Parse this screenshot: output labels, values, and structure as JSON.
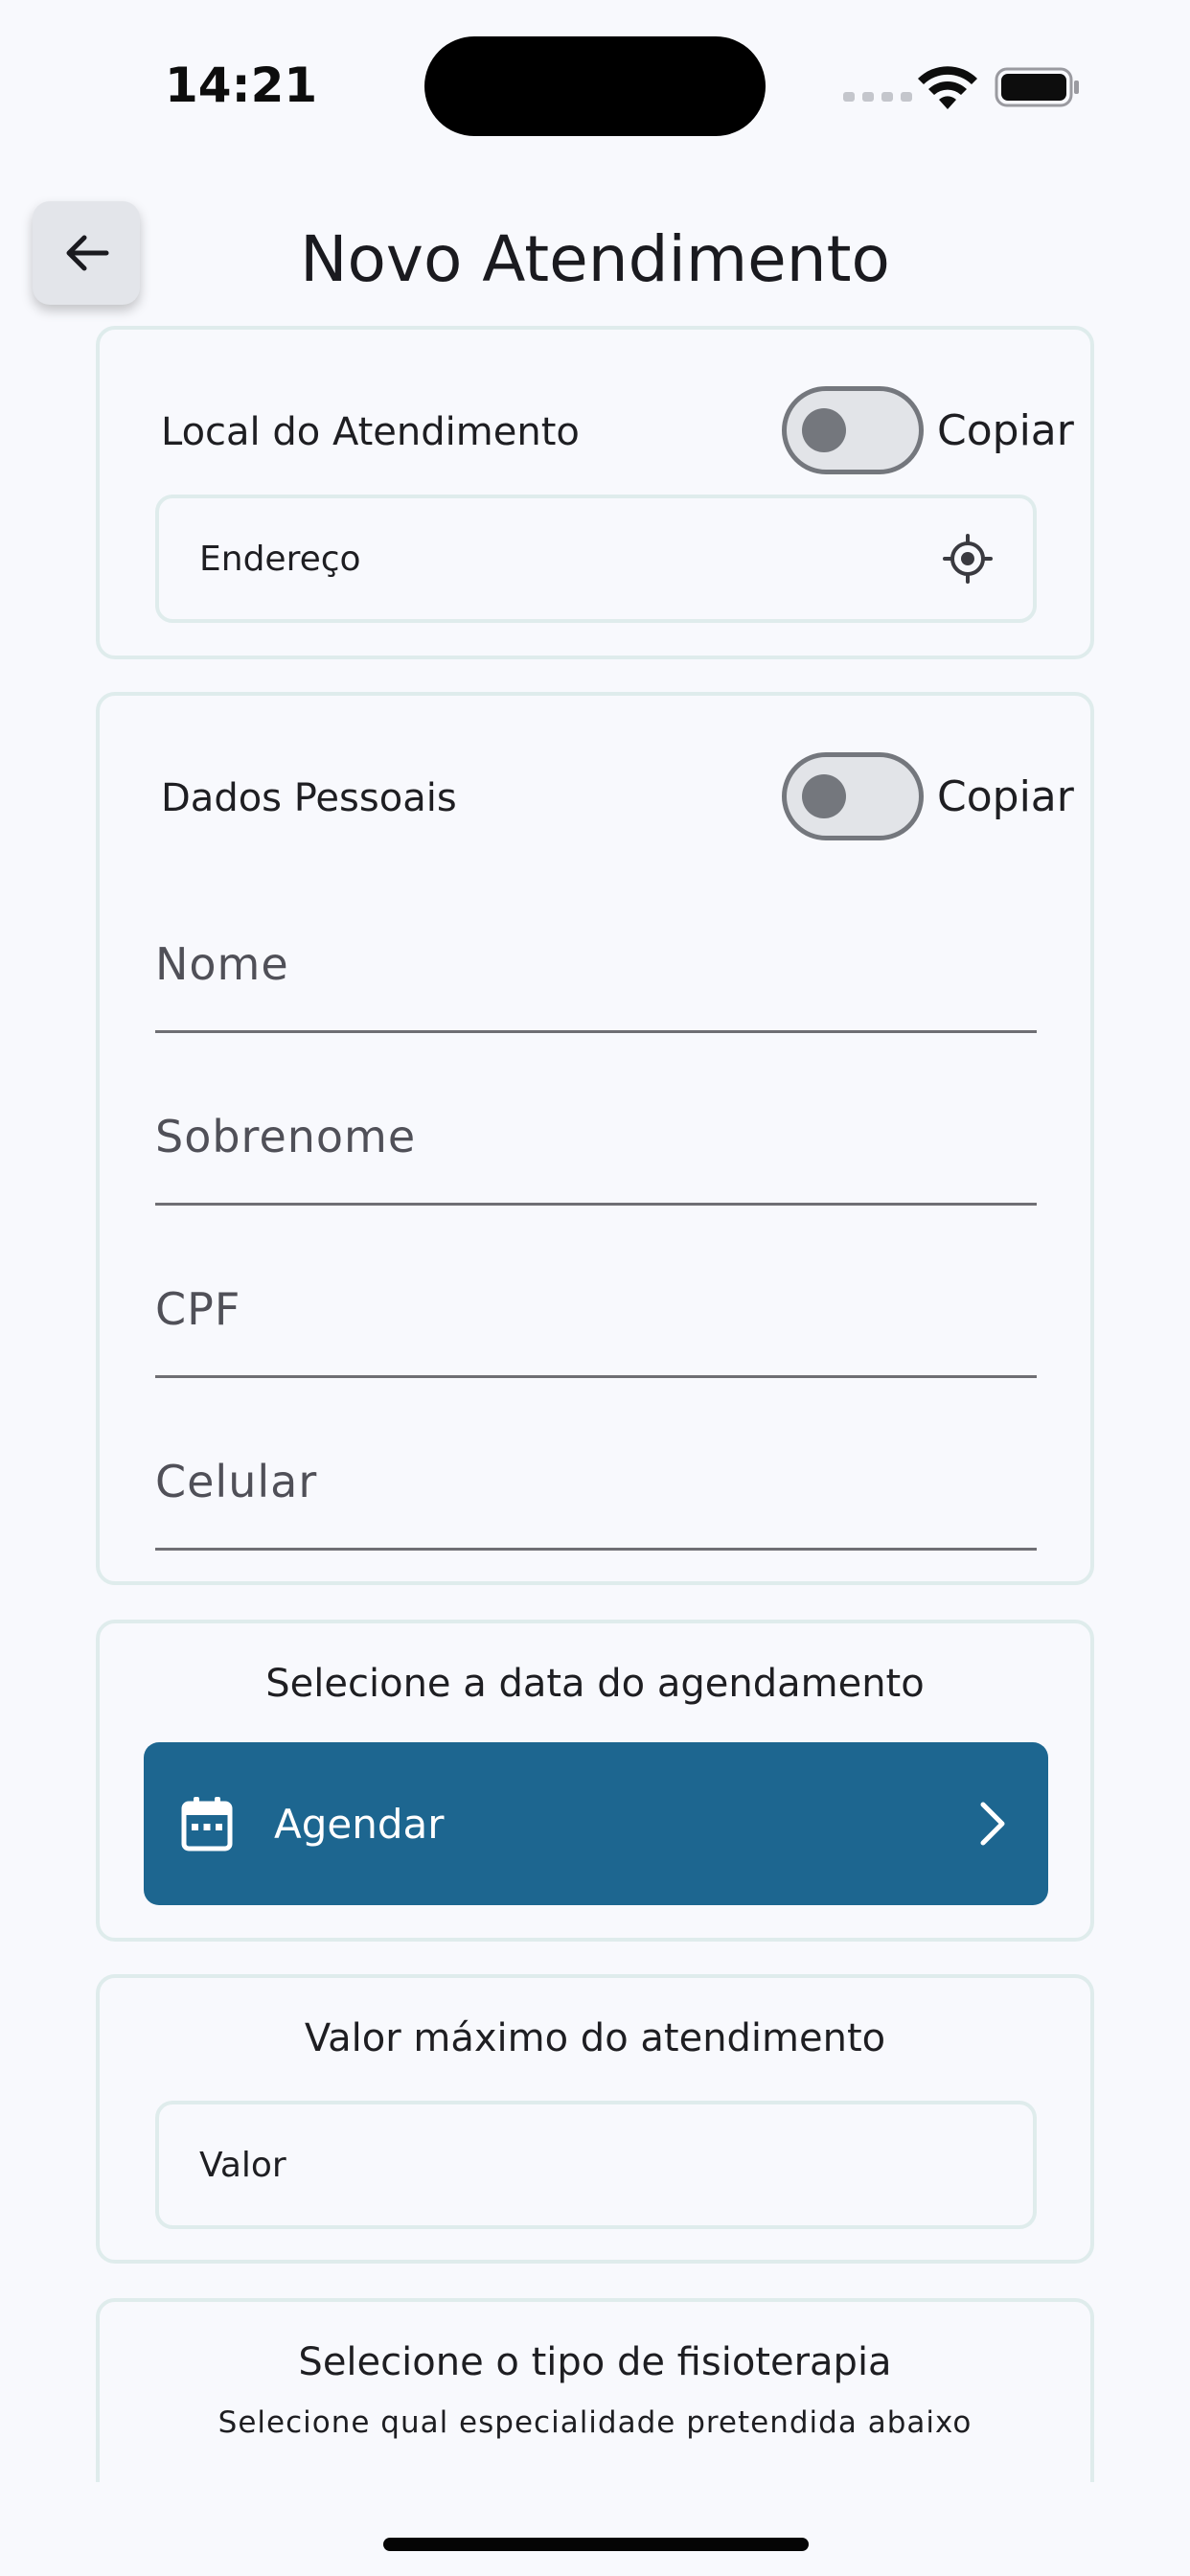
{
  "status_bar": {
    "time": "14:21"
  },
  "header": {
    "title": "Novo Atendimento",
    "back_icon": "arrow-left-icon"
  },
  "local_card": {
    "title": "Local do Atendimento",
    "copy_label": "Copiar",
    "copy_on": false,
    "address_placeholder": "Endereço",
    "address_icon": "gps-target-icon"
  },
  "personal_card": {
    "title": "Dados Pessoais",
    "copy_label": "Copiar",
    "copy_on": false,
    "fields": [
      {
        "placeholder": "Nome"
      },
      {
        "placeholder": "Sobrenome"
      },
      {
        "placeholder": "CPF"
      },
      {
        "placeholder": "Celular"
      }
    ]
  },
  "schedule_card": {
    "title": "Selecione a data do agendamento",
    "button_label": "Agendar",
    "button_icon": "calendar-icon",
    "chevron_icon": "chevron-right-icon"
  },
  "value_card": {
    "title": "Valor máximo do atendimento",
    "value_placeholder": "Valor"
  },
  "therapy_card": {
    "title": "Selecione o tipo de fisioterapia",
    "subtitle": "Selecione qual especialidade pretendida abaixo"
  },
  "colors": {
    "primary": "#1d6690",
    "card_border": "#dfecec",
    "background": "#f8f9fd",
    "toggle_off": "#74777d"
  }
}
